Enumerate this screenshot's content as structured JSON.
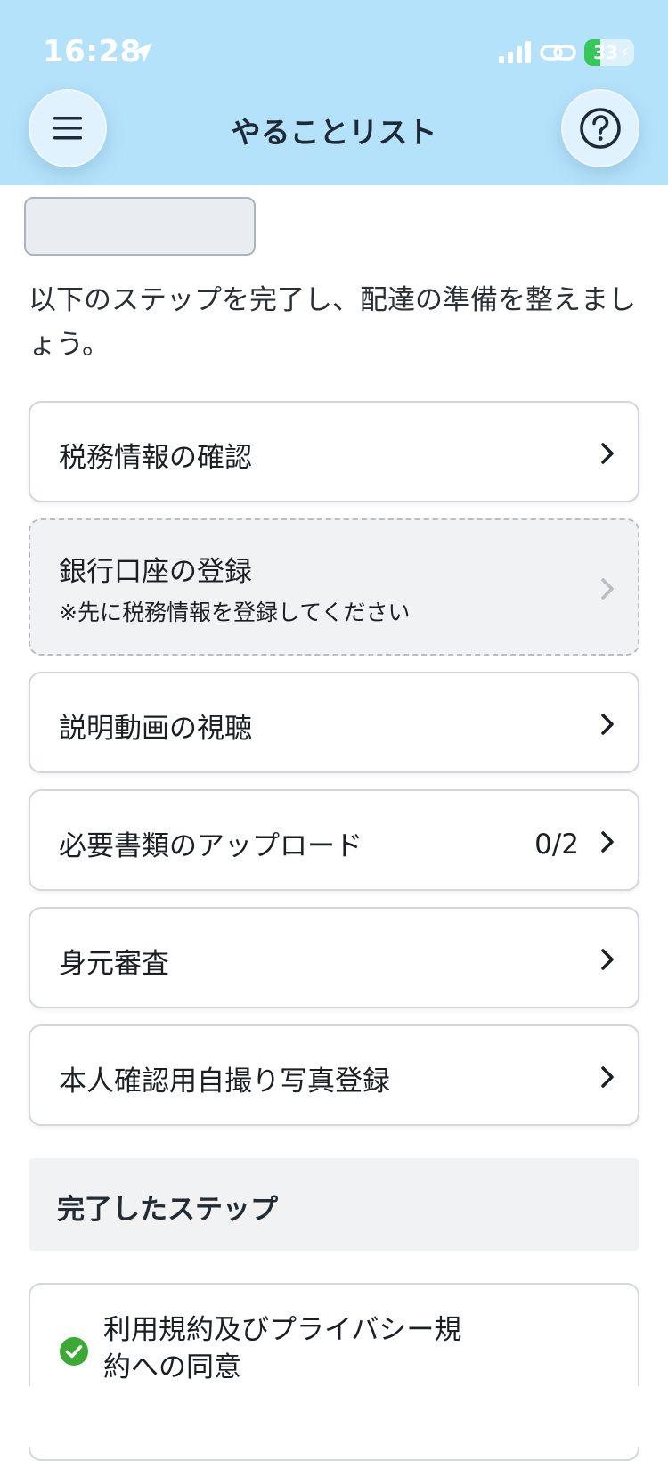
{
  "status_bar": {
    "time": "16:28",
    "battery": "33",
    "battery_level": 0.33
  },
  "header": {
    "title": "やることリスト",
    "menu_icon": "hamburger-menu-icon",
    "help_icon": "question-circle-icon"
  },
  "intro": "以下のステップを完了し、配達の準備を整えましょう。",
  "steps": [
    {
      "label": "税務情報の確認",
      "count": "",
      "disabled": false
    },
    {
      "label": "銀行口座の登録",
      "note": "※先に税務情報を登録してください",
      "disabled": true
    },
    {
      "label": "説明動画の視聴",
      "count": ""
    },
    {
      "label": "必要書類のアップロード",
      "count": "0/2"
    },
    {
      "label": "身元審査",
      "count": ""
    },
    {
      "label": "本人確認用自撮り写真登録",
      "count": ""
    }
  ],
  "completed": {
    "title": "完了したステップ",
    "items": [
      {
        "label": "利用規約及びプライバシー規約への同意",
        "status": "done"
      }
    ]
  },
  "colors": {
    "header_bg": "#b5e2fb",
    "check": "#3aaa35",
    "battery": "#34c759"
  }
}
